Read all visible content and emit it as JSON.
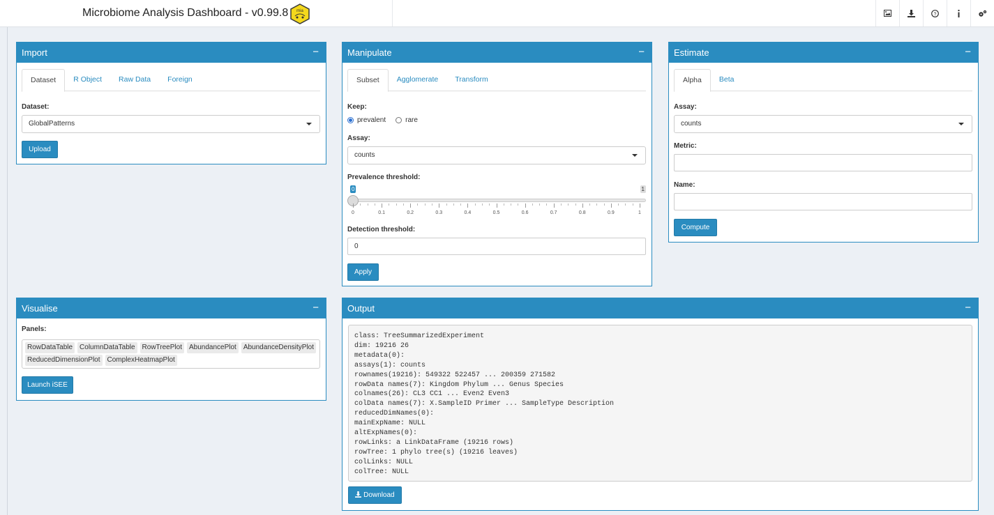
{
  "header": {
    "title": "Microbiome Analysis Dashboard - v0.99.8",
    "logo_text": "mia",
    "nav_icons": [
      "image-icon",
      "download-icon",
      "help-icon",
      "info-icon",
      "settings-icon"
    ]
  },
  "colors": {
    "primary": "#2a8cc0",
    "background": "#ecf0f5"
  },
  "import_box": {
    "title": "Import",
    "collapse": "−",
    "tabs": [
      "Dataset",
      "R Object",
      "Raw Data",
      "Foreign"
    ],
    "dataset_label": "Dataset:",
    "dataset_value": "GlobalPatterns",
    "upload_label": "Upload"
  },
  "manipulate_box": {
    "title": "Manipulate",
    "collapse": "−",
    "tabs": [
      "Subset",
      "Agglomerate",
      "Transform"
    ],
    "keep_label": "Keep:",
    "keep_options": [
      "prevalent",
      "rare"
    ],
    "assay_label": "Assay:",
    "assay_value": "counts",
    "prevalence_label": "Prevalence threshold:",
    "prevalence_value": "0",
    "prevalence_max": "1",
    "slider_ticks": [
      "0",
      "0.1",
      "0.2",
      "0.3",
      "0.4",
      "0.5",
      "0.6",
      "0.7",
      "0.8",
      "0.9",
      "1"
    ],
    "detection_label": "Detection threshold:",
    "detection_value": "0",
    "apply_label": "Apply"
  },
  "estimate_box": {
    "title": "Estimate",
    "collapse": "−",
    "tabs": [
      "Alpha",
      "Beta"
    ],
    "assay_label": "Assay:",
    "assay_value": "counts",
    "metric_label": "Metric:",
    "metric_value": "",
    "name_label": "Name:",
    "name_value": "",
    "compute_label": "Compute"
  },
  "visualise_box": {
    "title": "Visualise",
    "collapse": "−",
    "panels_label": "Panels:",
    "panels": [
      "RowDataTable",
      "ColumnDataTable",
      "RowTreePlot",
      "AbundancePlot",
      "AbundanceDensityPlot",
      "ReducedDimensionPlot",
      "ComplexHeatmapPlot"
    ],
    "launch_label": "Launch iSEE"
  },
  "output_box": {
    "title": "Output",
    "collapse": "−",
    "console_lines": [
      "class: TreeSummarizedExperiment",
      "dim: 19216 26",
      "metadata(0):",
      "assays(1): counts",
      "rownames(19216): 549322 522457 ... 200359 271582",
      "rowData names(7): Kingdom Phylum ... Genus Species",
      "colnames(26): CL3 CC1 ... Even2 Even3",
      "colData names(7): X.SampleID Primer ... SampleType Description",
      "reducedDimNames(0):",
      "mainExpName: NULL",
      "altExpNames(0):",
      "rowLinks: a LinkDataFrame (19216 rows)",
      "rowTree: 1 phylo tree(s) (19216 leaves)",
      "colLinks: NULL",
      "colTree: NULL"
    ],
    "download_label": "Download"
  }
}
